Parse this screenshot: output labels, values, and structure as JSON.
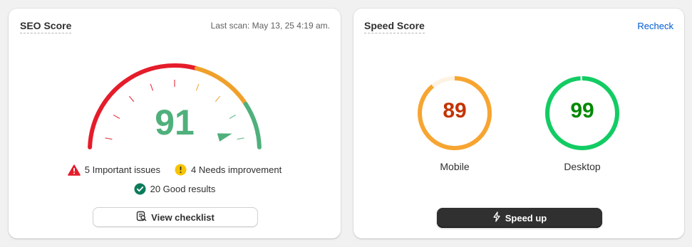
{
  "seo": {
    "title": "SEO Score",
    "last_scan": "Last scan: May 13, 25 4:19 am.",
    "score": "91",
    "score_value": 91,
    "issues": {
      "important": "5 Important issues",
      "needs_improvement": "4 Needs improvement",
      "good": "20 Good results"
    },
    "button_label": "View checklist",
    "colors": {
      "critical": "#e51c2a",
      "warning": "#f0a02a",
      "good": "#4fb07c",
      "score_text": "#4fb07c"
    }
  },
  "speed": {
    "title": "Speed Score",
    "recheck_label": "Recheck",
    "mobile": {
      "score": "89",
      "value": 89,
      "label": "Mobile",
      "ring_color": "#f7a531",
      "track_color": "#fdf3e2",
      "text_color": "#c33300"
    },
    "desktop": {
      "score": "99",
      "value": 99,
      "label": "Desktop",
      "ring_color": "#12cc63",
      "track_color": "#e3f8ec",
      "text_color": "#008800"
    },
    "button_label": "Speed up",
    "button_icon": "lightning-icon"
  }
}
